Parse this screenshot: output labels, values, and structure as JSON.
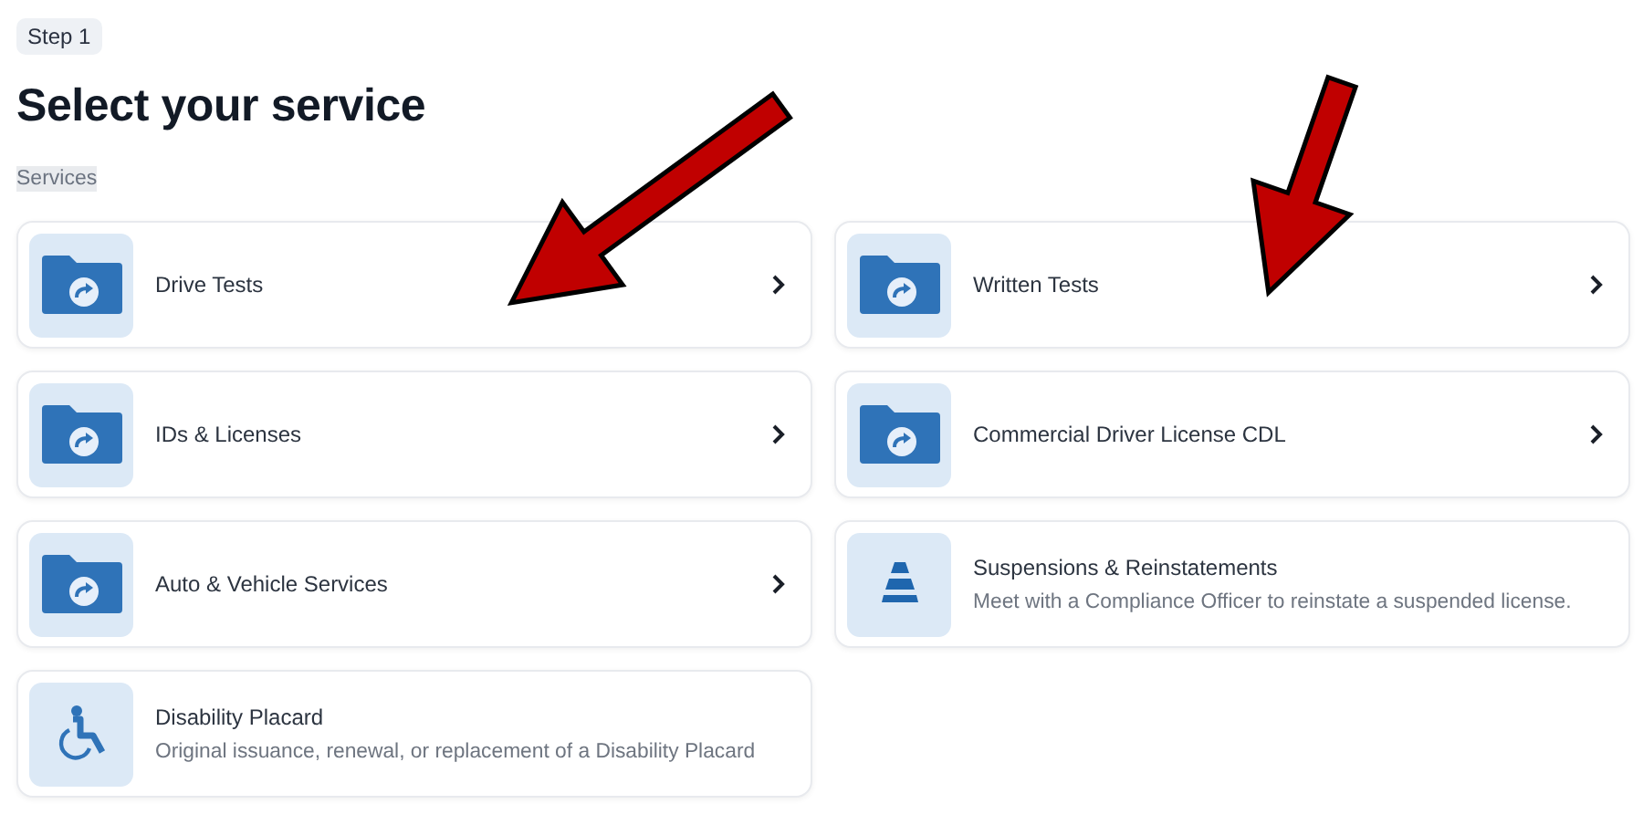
{
  "step": "Step 1",
  "title": "Select your service",
  "section": "Services",
  "services": [
    {
      "kind": "folder",
      "name": "Drive Tests"
    },
    {
      "kind": "folder",
      "name": "IDs & Licenses"
    },
    {
      "kind": "folder",
      "name": "Auto & Vehicle Services"
    },
    {
      "kind": "wheelchair",
      "name": "Disability Placard",
      "description": "Original issuance, renewal, or replacement of a Disability Placard"
    },
    {
      "kind": "folder",
      "name": "Written Tests"
    },
    {
      "kind": "folder",
      "name": "Commercial Driver License CDL"
    },
    {
      "kind": "cone",
      "name": "Suspensions & Reinstatements",
      "description": "Meet with a Compliance Officer to reinstate a suspended license."
    }
  ]
}
